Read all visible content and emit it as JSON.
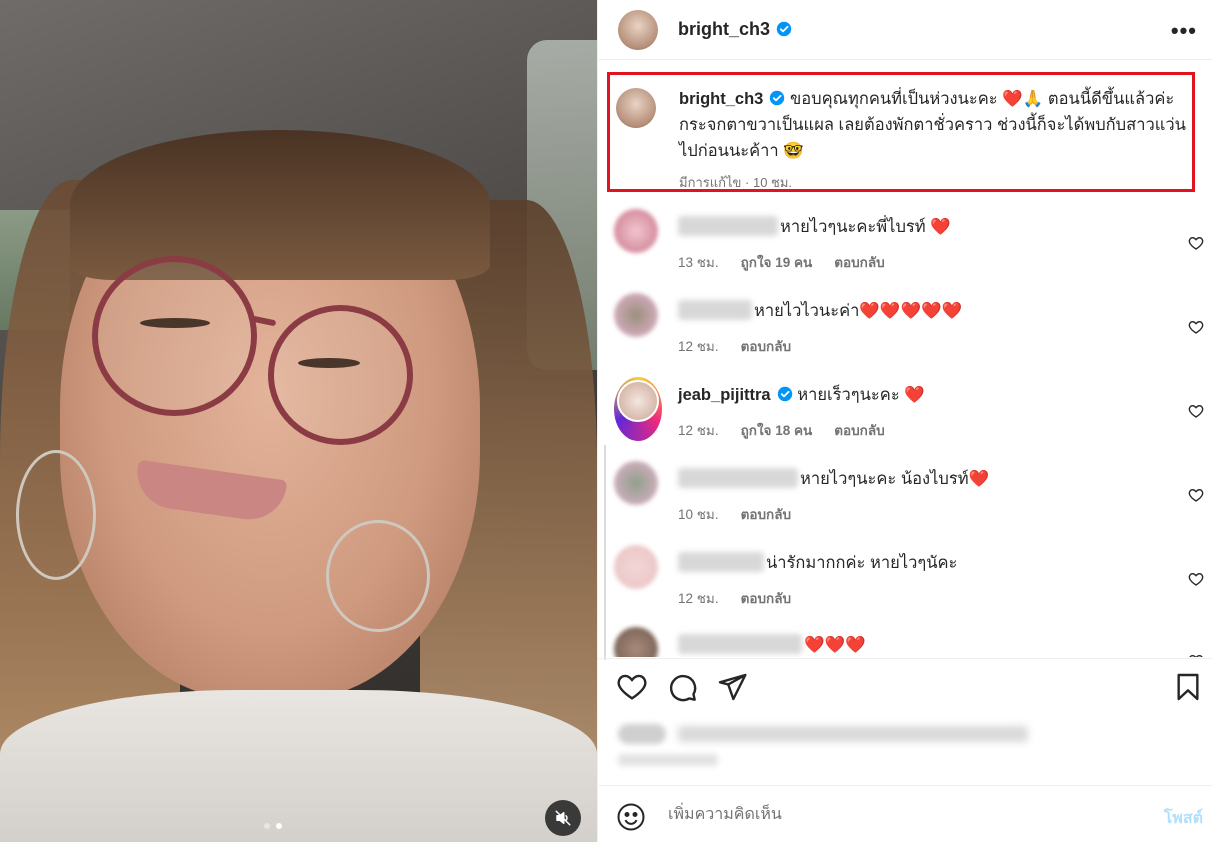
{
  "post": {
    "username": "bright_ch3",
    "caption": "ขอบคุณทุกคนที่เป็นห่วงนะคะ ❤️🙏 ตอนนี้ดีขึ้นแล้วค่ะ กระจกตาขวาเป็นแผล เลยต้องพักตาชั่วคราว ช่วงนี้ก็จะได้พบกับสาวแว่นไปก่อนนะค้าา 🤓",
    "edited_label": "มีการแก้ไข",
    "time": "10 ชม.",
    "more_label": "•••"
  },
  "comments": [
    {
      "text": "หายไวๆนะคะพี่ไบรท์ ❤️",
      "time": "13 ชม.",
      "likes": "ถูกใจ 19 คน",
      "reply": "ตอบกลับ"
    },
    {
      "text": "หายไวไวนะค่า❤️❤️❤️❤️❤️",
      "time": "12 ชม.",
      "reply": "ตอบกลับ"
    },
    {
      "username": "jeab_pijittra",
      "text": "หายเร็วๆนะคะ ❤️",
      "time": "12 ชม.",
      "likes": "ถูกใจ 18 คน",
      "reply": "ตอบกลับ"
    },
    {
      "text": "หายไวๆนะคะ น้องไบรท์❤️",
      "time": "10 ชม.",
      "reply": "ตอบกลับ"
    },
    {
      "text": "น่ารักมากกค่ะ หายไวๆนัคะ",
      "time": "12 ชม.",
      "reply": "ตอบกลับ"
    },
    {
      "text": "❤️❤️❤️"
    }
  ],
  "composer": {
    "placeholder": "เพิ่มความคิดเห็น",
    "post_label": "โพสต์"
  },
  "media": {
    "slides": 2,
    "active_slide": 2
  },
  "colors": {
    "highlight": "#e0141e",
    "verified": "#0095f6",
    "heart": "#ff3040"
  }
}
